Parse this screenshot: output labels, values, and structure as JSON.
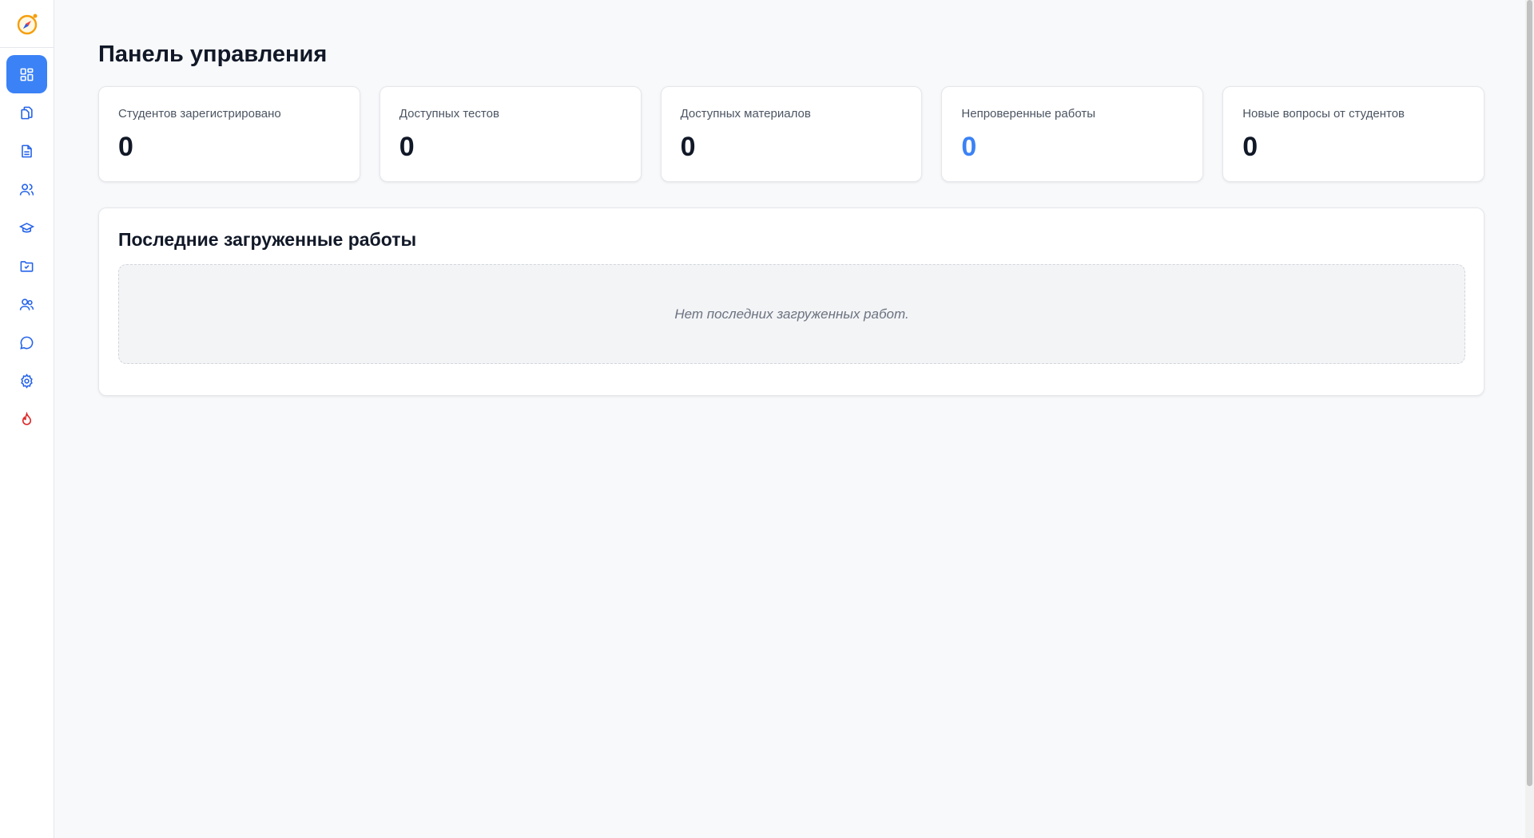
{
  "sidebar": {
    "logo_icon": "compass-icon",
    "items": [
      {
        "icon": "dashboard-icon",
        "active": true
      },
      {
        "icon": "files-icon",
        "active": false
      },
      {
        "icon": "document-icon",
        "active": false
      },
      {
        "icon": "users-icon",
        "active": false
      },
      {
        "icon": "graduation-cap-icon",
        "active": false
      },
      {
        "icon": "folder-check-icon",
        "active": false
      },
      {
        "icon": "students-icon",
        "active": false
      },
      {
        "icon": "chat-icon",
        "active": false
      },
      {
        "icon": "gear-icon",
        "active": false
      },
      {
        "icon": "flame-icon",
        "active": false,
        "color": "#dc2626"
      }
    ]
  },
  "page": {
    "title": "Панель управления"
  },
  "stats": [
    {
      "label": "Студентов зарегистрировано",
      "value": "0"
    },
    {
      "label": "Доступных тестов",
      "value": "0"
    },
    {
      "label": "Доступных материалов",
      "value": "0"
    },
    {
      "label": "Непроверенные работы",
      "value": "0",
      "color": "#3b82f6"
    },
    {
      "label": "Новые вопросы от студентов",
      "value": "0"
    }
  ],
  "recent": {
    "title": "Последние загруженные работы",
    "empty_text": "Нет последних загруженных работ."
  },
  "colors": {
    "accent": "#3b82f6",
    "danger": "#dc2626"
  }
}
